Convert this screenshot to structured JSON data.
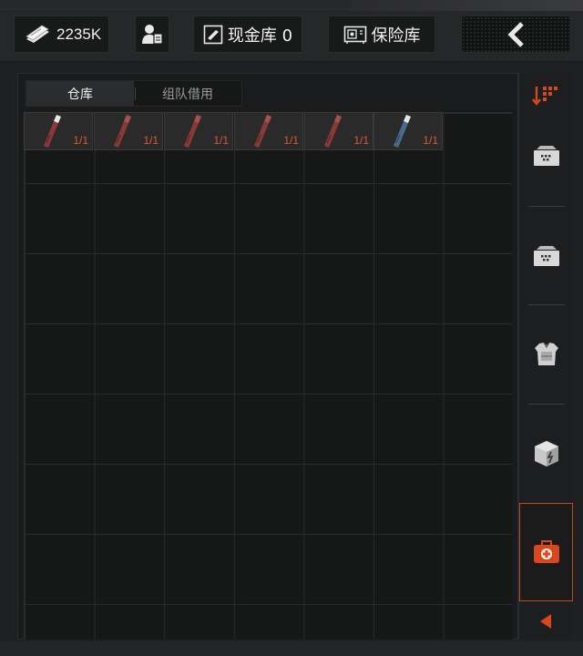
{
  "topbar": {
    "money": {
      "icon": "cash-bundle-icon",
      "amount": "2235K"
    },
    "profile": {
      "icon": "operator-profile-icon"
    },
    "cash_vault": {
      "icon": "cash-vault-icon",
      "label": "现金库 0"
    },
    "safe_box": {
      "icon": "safe-box-icon",
      "label": "保险库"
    },
    "back": {
      "icon": "chevron-left-icon"
    }
  },
  "panel": {
    "tabs": [
      {
        "label": "仓库",
        "active": true
      },
      {
        "label": "组队借用",
        "active": false
      }
    ],
    "items": [
      {
        "icon": "red-stick-item-icon",
        "count": "1/1",
        "color": "#8a3a36"
      },
      {
        "icon": "red-stick-item-icon",
        "count": "1/1",
        "color": "#8a3a36"
      },
      {
        "icon": "red-stick-item-icon",
        "count": "1/1",
        "color": "#8a3a36"
      },
      {
        "icon": "red-stick-item-icon",
        "count": "1/1",
        "color": "#8a3a36"
      },
      {
        "icon": "red-stick-item-icon",
        "count": "1/1",
        "color": "#8a3a36"
      },
      {
        "icon": "blue-stick-item-icon",
        "count": "1/1",
        "color": "#4a6a90"
      }
    ]
  },
  "sidebar": {
    "items": [
      {
        "icon": "sort-icon"
      },
      {
        "icon": "storage-crate-icon"
      },
      {
        "icon": "storage-crate-icon"
      },
      {
        "icon": "body-armor-icon"
      },
      {
        "icon": "supply-box-icon"
      },
      {
        "icon": "medical-kit-icon",
        "active": true
      },
      {
        "icon": "collapse-arrow-icon"
      }
    ]
  },
  "colors": {
    "accent": "#d9481c",
    "count_text": "#e0562e",
    "background": "#1f2021"
  }
}
